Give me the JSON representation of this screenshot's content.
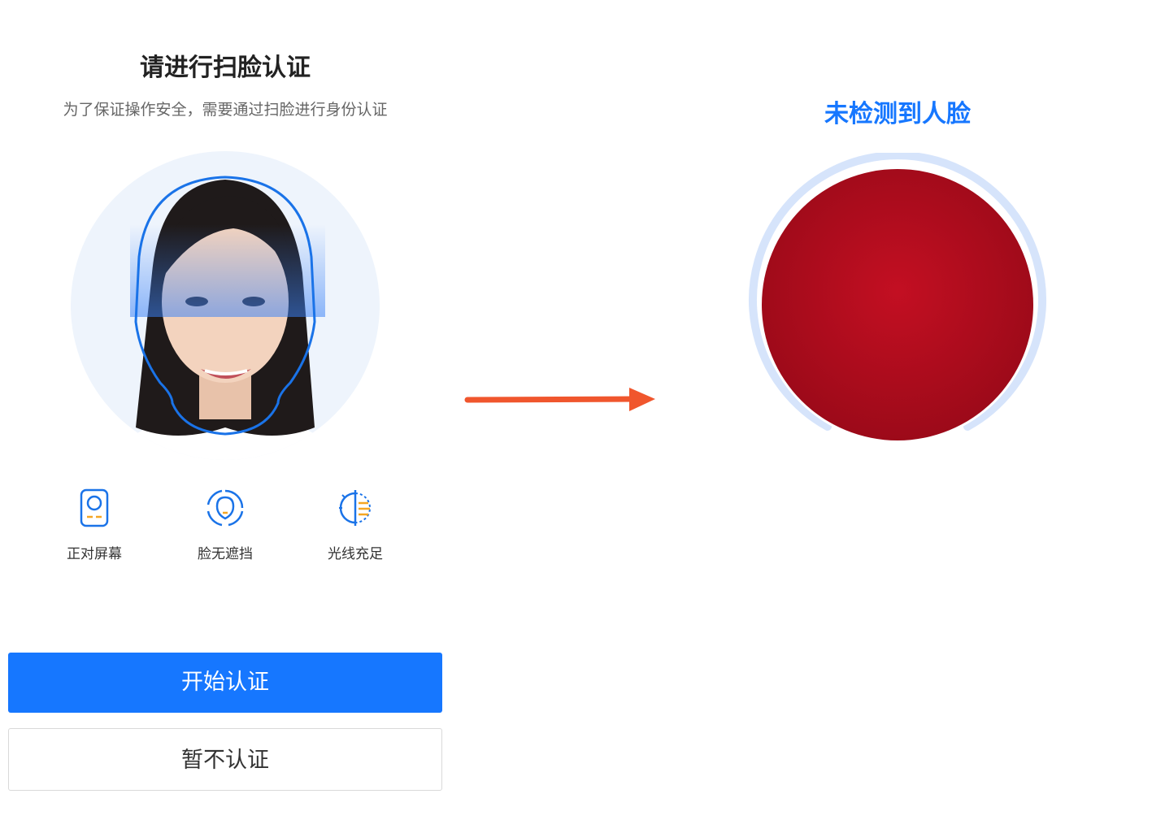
{
  "left": {
    "title": "请进行扫脸认证",
    "subtitle": "为了保证操作安全，需要通过扫脸进行身份认证",
    "tips": [
      {
        "label": "正对屏幕",
        "icon": "phone-face-icon"
      },
      {
        "label": "脸无遮挡",
        "icon": "face-outline-icon"
      },
      {
        "label": "光线充足",
        "icon": "light-icon"
      }
    ],
    "primary_button": "开始认证",
    "secondary_button": "暂不认证"
  },
  "right": {
    "status": "未检测到人脸"
  },
  "colors": {
    "accent": "#1677ff",
    "status_text": "#1677ff",
    "arrow": "#f0562d",
    "tip_highlight": "#f5a623",
    "detect_fill": "#b00d1e",
    "ring": "#d6e4fb"
  }
}
